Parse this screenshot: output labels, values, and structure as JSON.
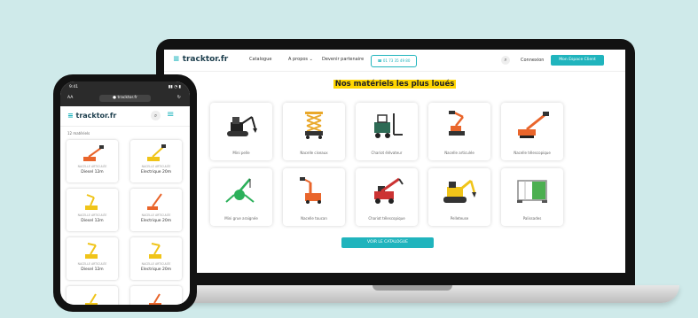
{
  "site": {
    "logo": "tracktor.fr",
    "logo_mark": "≡",
    "nav": {
      "catalogue": "Catalogue",
      "apropos": "A propos ⌄",
      "devenir": "Devenir partenaire"
    },
    "phone": "☎ 01 73 35 49 80",
    "search_icon": "⌕",
    "connect": "Connexion",
    "cta": "Mon Espace Client",
    "section_title": "Nos matériels les plus loués",
    "catalog_button": "VOIR LE CATALOGUE",
    "cards": [
      {
        "label": "Mini pelle"
      },
      {
        "label": "Nacelle ciseaux"
      },
      {
        "label": "Chariot élévateur"
      },
      {
        "label": "Nacelle articulée"
      },
      {
        "label": "Nacelle télescopique"
      },
      {
        "label": "Mini grue araignée"
      },
      {
        "label": "Nacelle toucan"
      },
      {
        "label": "Chariot télescopique"
      },
      {
        "label": "Pelleteuse"
      },
      {
        "label": "Palissades"
      }
    ]
  },
  "mobile": {
    "time": "9:41",
    "status_icons": "▮▮ ◔ ▮",
    "aa": "AA",
    "url": "● tracktor.fr",
    "reload": "↻",
    "logo": "tracktor.fr",
    "logo_mark": "≡",
    "search_icon": "⌕",
    "menu_icon": "≡",
    "count": "12 matériels",
    "cards": [
      {
        "sub": "NACELLE ARTICULÉE",
        "name": "Diesel 12m"
      },
      {
        "sub": "NACELLE ARTICULÉE",
        "name": "Electrique 20m"
      },
      {
        "sub": "NACELLE ARTICULÉE",
        "name": "Diesel 12m"
      },
      {
        "sub": "NACELLE ARTICULÉE",
        "name": "Electrique 20m"
      },
      {
        "sub": "NACELLE ARTICULÉE",
        "name": "Diesel 12m"
      },
      {
        "sub": "NACELLE ARTICULÉE",
        "name": "Electrique 20m"
      },
      {
        "sub": "",
        "name": ""
      },
      {
        "sub": "",
        "name": ""
      }
    ]
  },
  "colors": {
    "accent": "#20b4bd",
    "yellow": "#ffd600",
    "orange": "#e9652b",
    "dark": "#1b3d4c",
    "background": "#cfeaea"
  }
}
